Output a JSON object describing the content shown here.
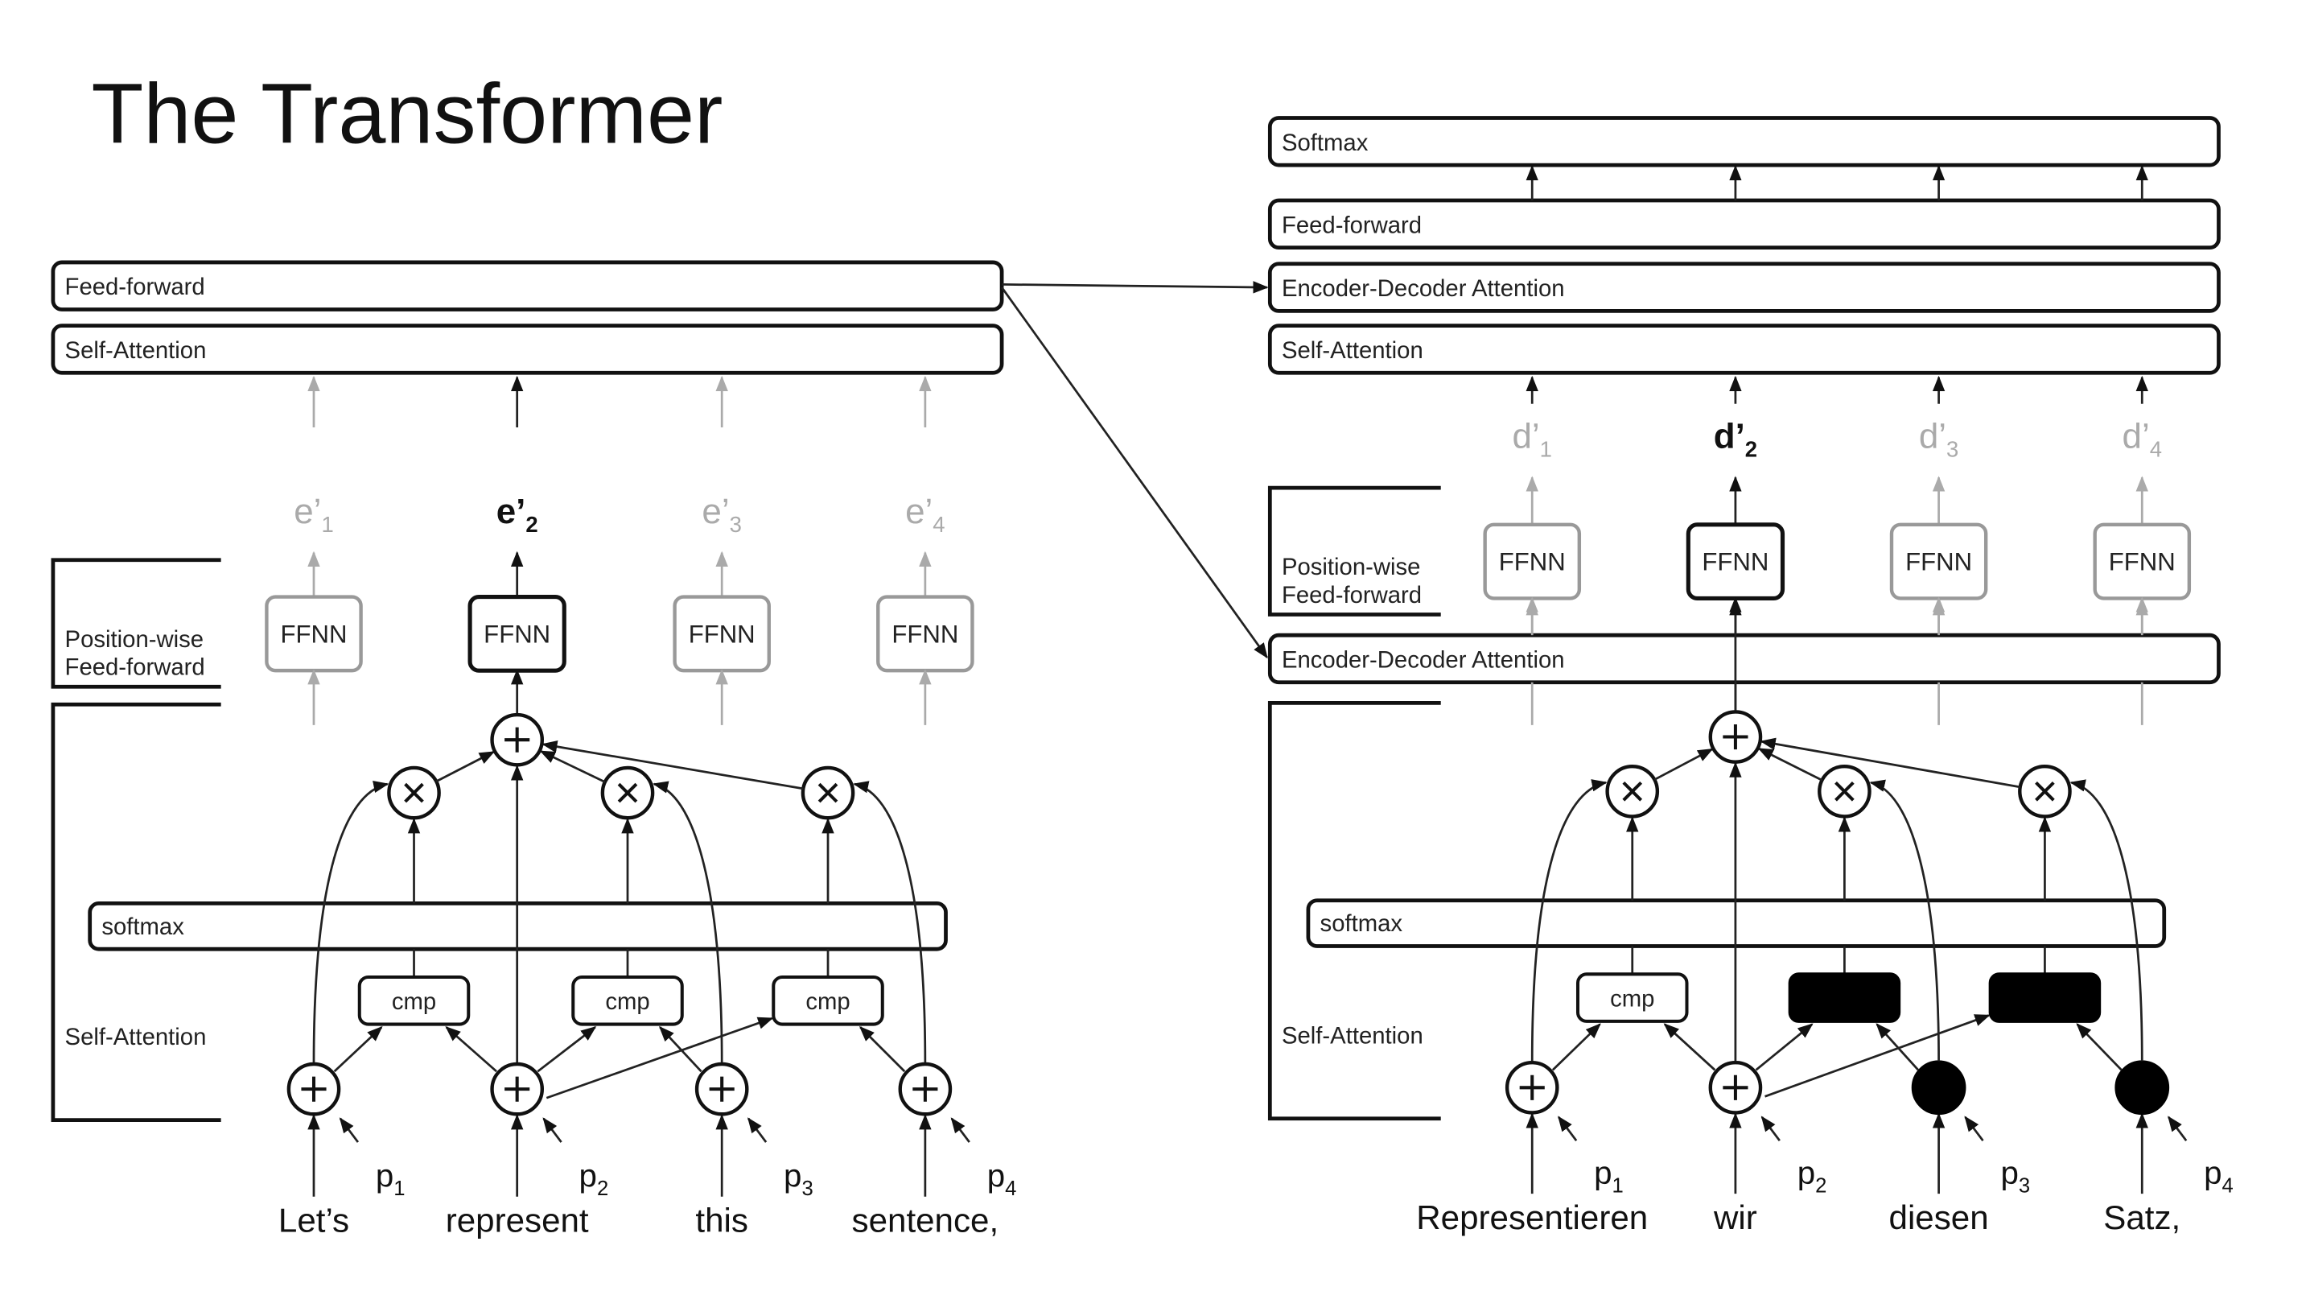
{
  "title": "The Transformer",
  "encoder": {
    "top_blocks": [
      "Feed-forward",
      "Self-Attention"
    ],
    "outputs": [
      {
        "label": "e’",
        "sub": "1",
        "highlighted": false
      },
      {
        "label": "e’",
        "sub": "2",
        "highlighted": true
      },
      {
        "label": "e’",
        "sub": "3",
        "highlighted": false
      },
      {
        "label": "e’",
        "sub": "4",
        "highlighted": false
      }
    ],
    "ffnn_label": "FFNN",
    "position_wise_label_line1": "Position-wise",
    "position_wise_label_line2": "Feed-forward",
    "self_attention_label": "Self-Attention",
    "softmax_label": "softmax",
    "cmp_label": "cmp",
    "plus_symbol": "+",
    "times_symbol": "×",
    "words": [
      "Let’s",
      "represent",
      "this",
      "sentence,"
    ],
    "positions": [
      {
        "label": "p",
        "sub": "1"
      },
      {
        "label": "p",
        "sub": "2"
      },
      {
        "label": "p",
        "sub": "3"
      },
      {
        "label": "p",
        "sub": "4"
      }
    ]
  },
  "decoder": {
    "top_blocks": [
      "Softmax",
      "Feed-forward",
      "Encoder-Decoder Attention",
      "Self-Attention"
    ],
    "outputs": [
      {
        "label": "d’",
        "sub": "1",
        "highlighted": false
      },
      {
        "label": "d’",
        "sub": "2",
        "highlighted": true
      },
      {
        "label": "d’",
        "sub": "3",
        "highlighted": false
      },
      {
        "label": "d’",
        "sub": "4",
        "highlighted": false
      }
    ],
    "ffnn_label": "FFNN",
    "position_wise_label_line1": "Position-wise",
    "position_wise_label_line2": "Feed-forward",
    "enc_dec_attention_label": "Encoder-Decoder Attention",
    "self_attention_label": "Self-Attention",
    "softmax_label": "softmax",
    "cmp_label": "cmp",
    "masked_positions": [
      3,
      4
    ],
    "words": [
      "Representieren",
      "wir",
      "diesen",
      "Satz,"
    ],
    "positions": [
      {
        "label": "p",
        "sub": "1"
      },
      {
        "label": "p",
        "sub": "2"
      },
      {
        "label": "p",
        "sub": "3"
      },
      {
        "label": "p",
        "sub": "4"
      }
    ]
  },
  "colors": {
    "ink": "#111111",
    "dimmed": "#999999",
    "background": "#ffffff"
  }
}
